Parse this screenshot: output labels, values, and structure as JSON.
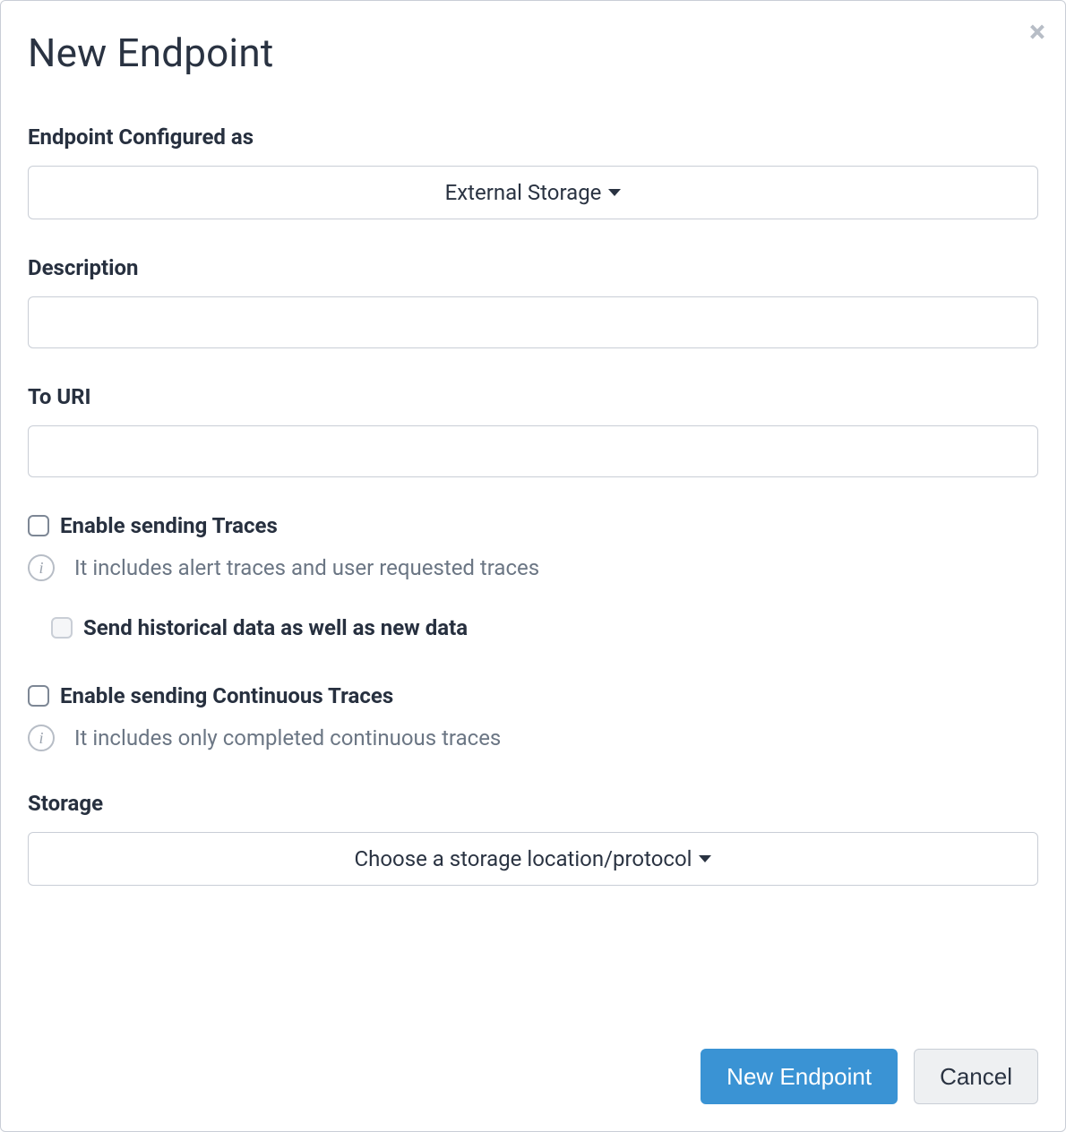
{
  "modal": {
    "title": "New Endpoint",
    "close_icon": "close-icon"
  },
  "fields": {
    "configured_as": {
      "label": "Endpoint Configured as",
      "value": "External Storage"
    },
    "description": {
      "label": "Description",
      "value": ""
    },
    "to_uri": {
      "label": "To URI",
      "value": ""
    },
    "enable_traces": {
      "label": "Enable sending Traces",
      "checked": false,
      "hint": "It includes alert traces and user requested traces"
    },
    "send_historical": {
      "label": "Send historical data as well as new data",
      "checked": false
    },
    "enable_continuous": {
      "label": "Enable sending Continuous Traces",
      "checked": false,
      "hint": "It includes only completed continuous traces"
    },
    "storage": {
      "label": "Storage",
      "value": "Choose a storage location/protocol"
    }
  },
  "footer": {
    "primary": "New Endpoint",
    "cancel": "Cancel"
  }
}
